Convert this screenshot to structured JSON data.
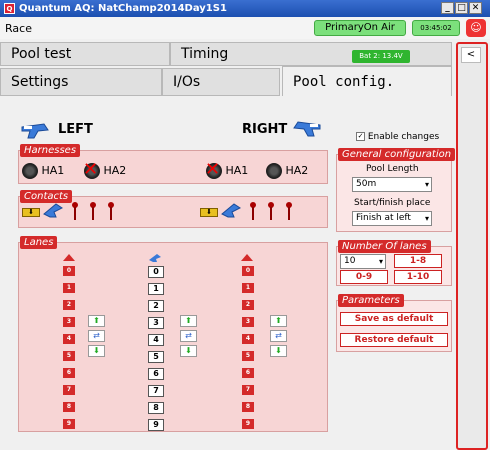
{
  "window": {
    "title": "Quantum AQ: NatChamp2014Day1S1",
    "controls": [
      "_",
      "□",
      "✕"
    ]
  },
  "status": {
    "race_label": "Race",
    "primary": "PrimaryOn Air",
    "clock": "03:45:02",
    "battery": "Bat 2: 13.4V"
  },
  "tabs": {
    "row1": [
      "Pool test",
      "Timing"
    ],
    "row2": [
      "Settings",
      "I/Os",
      "Pool config."
    ]
  },
  "sides": {
    "left": "LEFT",
    "right": "RIGHT"
  },
  "enable_changes": "Enable changes",
  "harnesses": {
    "title": "Harnesses",
    "left": [
      "HA1",
      "HA2"
    ],
    "right": [
      "HA1",
      "HA2"
    ]
  },
  "contacts": {
    "title": "Contacts"
  },
  "general": {
    "title": "General configuration",
    "pool_length_label": "Pool Length",
    "pool_length": "50m",
    "start_finish_label": "Start/finish place",
    "start_finish": "Finish at left"
  },
  "lanes": {
    "title": "Lanes",
    "left": [
      "0",
      "1",
      "2",
      "3",
      "4",
      "5",
      "6",
      "7",
      "8",
      "9"
    ],
    "middle": [
      "0",
      "1",
      "2",
      "3",
      "4",
      "5",
      "6",
      "7",
      "8",
      "9"
    ],
    "right": [
      "0",
      "1",
      "2",
      "3",
      "4",
      "5",
      "6",
      "7",
      "8",
      "9"
    ]
  },
  "number_of_lanes": {
    "title": "Number Of lanes",
    "value": "10",
    "btn_1_8": "1-8",
    "btn_0_9": "0-9",
    "btn_1_10": "1-10"
  },
  "parameters": {
    "title": "Parameters",
    "save": "Save as default",
    "restore": "Restore default"
  },
  "right_panel": {
    "collapse": "<"
  },
  "colors": {
    "accent": "#d42a2a",
    "section_bg": "#f7d5d5",
    "onair": "#7ce07c",
    "battery": "#2fb52f"
  }
}
